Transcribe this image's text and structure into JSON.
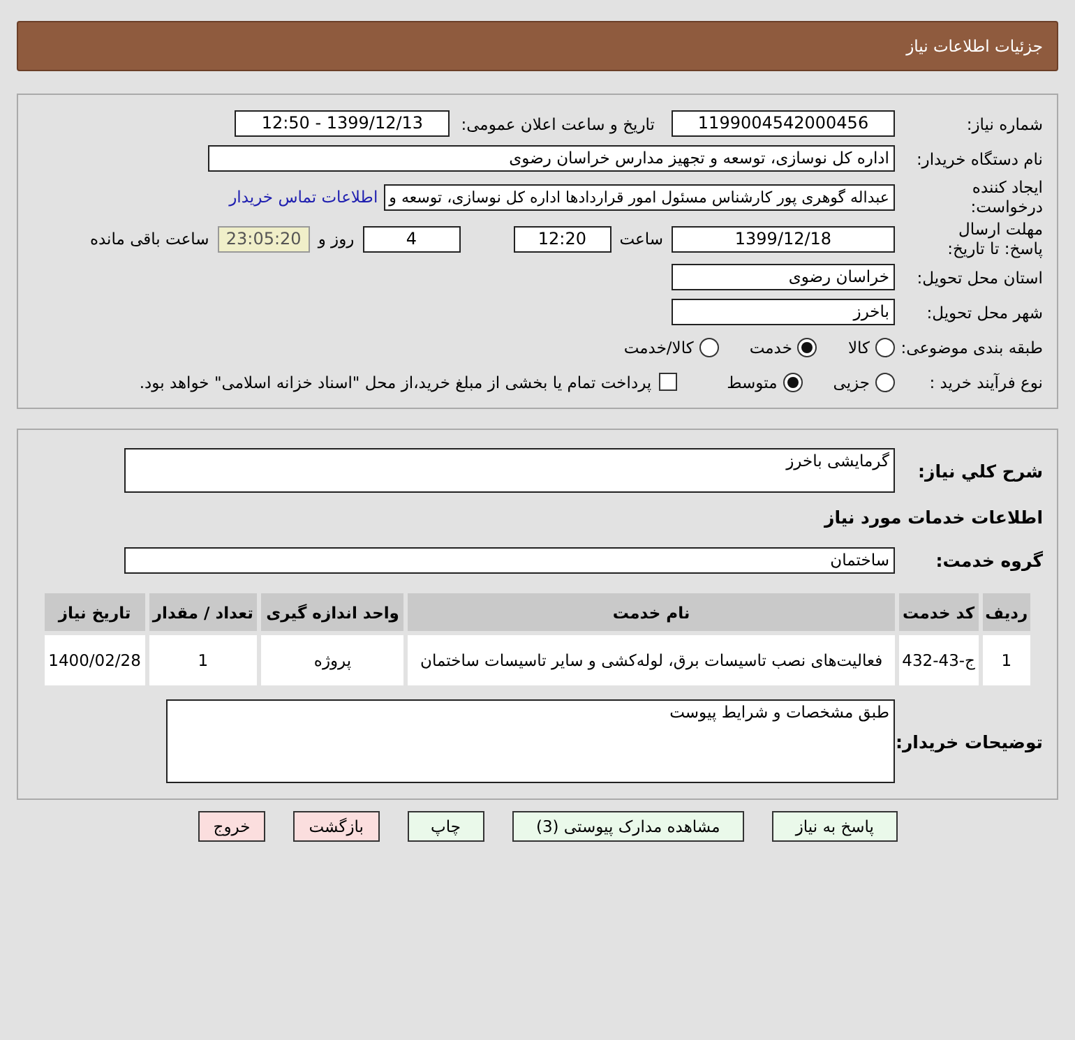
{
  "header": {
    "title": "جزئیات اطلاعات نیاز"
  },
  "need": {
    "number": {
      "label": "شماره نیاز:",
      "value": "1199004542000456"
    },
    "announce": {
      "label": "تاریخ و ساعت اعلان عمومی:",
      "value": "1399/12/13 - 12:50"
    },
    "buyer": {
      "label": "نام دستگاه خریدار:",
      "value": "اداره کل نوسازی، توسعه و تجهیز مدارس خراسان رضوی"
    },
    "creator": {
      "label": "ایجاد کننده درخواست:",
      "value": "عبداله گوهری پور کارشناس مسئول امور قراردادها  اداره کل نوسازی، توسعه و",
      "link": "اطلاعات تماس خریدار"
    },
    "deadline": {
      "label": "مهلت ارسال پاسخ: تا تاریخ:",
      "date": "1399/12/18",
      "time_label": "ساعت",
      "time": "12:20",
      "days": "4",
      "days_label": "روز و",
      "remaining": "23:05:20",
      "remaining_label": "ساعت باقی مانده"
    },
    "province": {
      "label": "استان محل تحویل:",
      "value": "خراسان رضوی"
    },
    "city": {
      "label": "شهر محل تحویل:",
      "value": "باخرز"
    },
    "category": {
      "label": "طبقه بندی موضوعی:",
      "options": [
        {
          "label": "کالا",
          "selected": false
        },
        {
          "label": "خدمت",
          "selected": true
        },
        {
          "label": "کالا/خدمت",
          "selected": false
        }
      ]
    },
    "process": {
      "label": "نوع فرآیند خرید :",
      "options": [
        {
          "label": "جزیی",
          "selected": false
        },
        {
          "label": "متوسط",
          "selected": true
        }
      ],
      "payment": {
        "label": "پرداخت تمام یا بخشی از مبلغ خرید،از محل \"اسناد خزانه اسلامی\" خواهد بود.",
        "checked": false
      }
    }
  },
  "details": {
    "description": {
      "label": "شرح کلي نیاز:",
      "value": "گرمایشی باخرز"
    },
    "services_heading": "اطلاعات خدمات مورد نیاز",
    "service_group": {
      "label": "گروه خدمت:",
      "value": "ساختمان"
    },
    "table": {
      "columns": [
        "ردیف",
        "کد خدمت",
        "نام خدمت",
        "واحد اندازه گیری",
        "تعداد / مقدار",
        "تاریخ نیاز"
      ],
      "rows": [
        [
          "1",
          "ج-43-432",
          "فعالیت‌های نصب تاسیسات برق، لوله‌کشی و سایر تاسیسات ساختمان",
          "پروژه",
          "1",
          "1400/02/28"
        ]
      ]
    },
    "buyer_notes": {
      "label": "توضیحات خریدار:",
      "value": "طبق مشخصات و شرایط پیوست"
    }
  },
  "buttons": [
    {
      "label": "پاسخ به نیاز",
      "kind": "normal"
    },
    {
      "label": "مشاهده مدارک پیوستی (3)",
      "kind": "normal"
    },
    {
      "label": "چاپ",
      "kind": "normal"
    },
    {
      "label": "بازگشت",
      "kind": "alert"
    },
    {
      "label": "خروج",
      "kind": "alert"
    }
  ]
}
